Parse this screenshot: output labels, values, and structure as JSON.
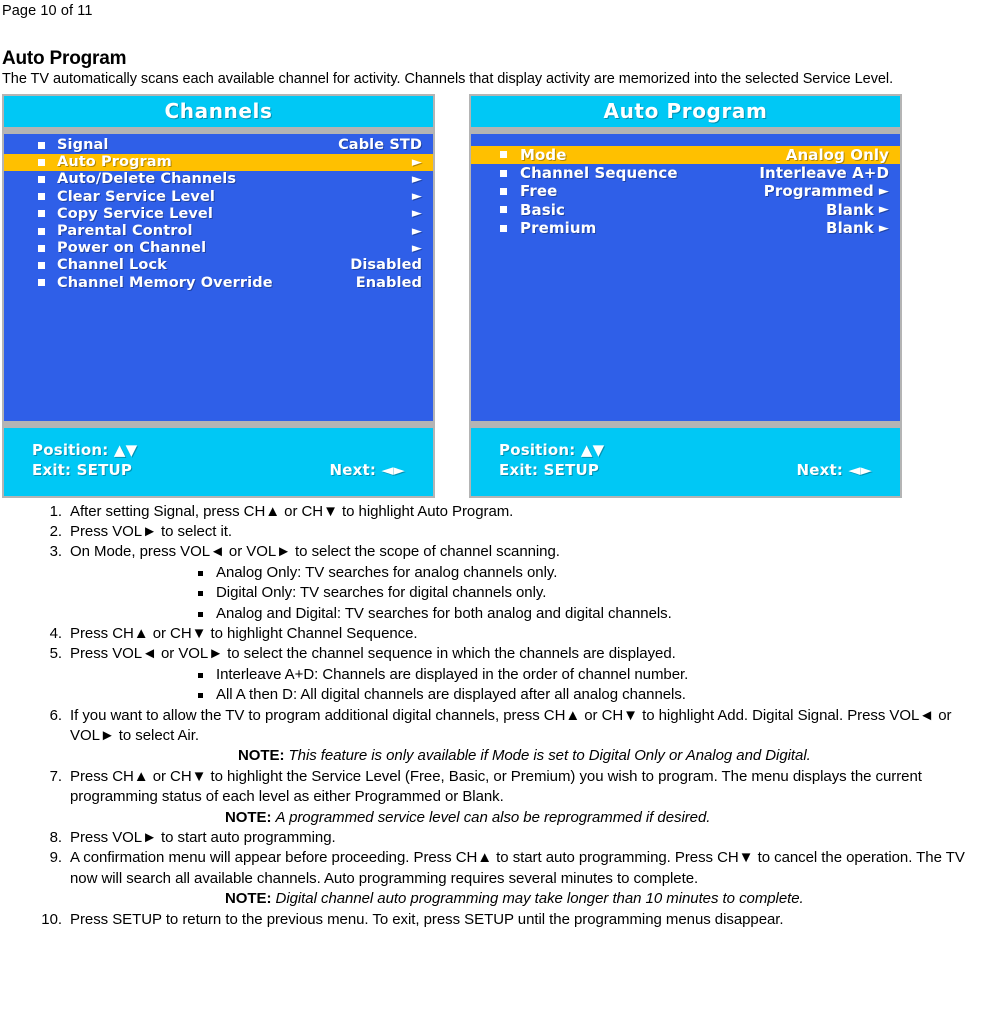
{
  "page_header": "Page 10 of 11",
  "section": {
    "title": "Auto Program",
    "intro": "The TV automatically scans each available channel for activity. Channels that display activity are memorized into the selected Service Level."
  },
  "colors": {
    "osd_header_bg": "#00c8f5",
    "osd_body_bg": "#2f5fe8",
    "osd_highlight_bg": "#ffc000",
    "osd_border": "#b4b4b4",
    "osd_text": "#ffffff"
  },
  "osd_panels": [
    {
      "id": "channels-menu",
      "title": "Channels",
      "rows": [
        {
          "label": "Signal",
          "value": "Cable STD",
          "arrow": "",
          "selected": false
        },
        {
          "label": "Auto Program",
          "value": "",
          "arrow": "►",
          "selected": true
        },
        {
          "label": "Auto/Delete Channels",
          "value": "",
          "arrow": "►",
          "selected": false
        },
        {
          "label": "Clear Service Level",
          "value": "",
          "arrow": "►",
          "selected": false
        },
        {
          "label": "Copy Service Level",
          "value": "",
          "arrow": "►",
          "selected": false
        },
        {
          "label": "Parental Control",
          "value": "",
          "arrow": "►",
          "selected": false
        },
        {
          "label": "Power on Channel",
          "value": "",
          "arrow": "►",
          "selected": false
        },
        {
          "label": "Channel Lock",
          "value": "Disabled",
          "arrow": "",
          "selected": false
        },
        {
          "label": "Channel Memory Override",
          "value": "Enabled",
          "arrow": "",
          "selected": false
        }
      ],
      "footer": {
        "position": "Position: ▲▼",
        "exit": "Exit: SETUP",
        "next": "Next: ◄►"
      }
    },
    {
      "id": "auto-program-menu",
      "title": "Auto Program",
      "rows": [
        {
          "label": "Mode",
          "value": "Analog Only",
          "arrow": "",
          "selected": true
        },
        {
          "label": "Channel Sequence",
          "value": "Interleave A+D",
          "arrow": "",
          "selected": false
        },
        {
          "label": "Free",
          "value": "Programmed",
          "arrow": "►",
          "selected": false
        },
        {
          "label": "Basic",
          "value": "Blank",
          "arrow": "►",
          "selected": false
        },
        {
          "label": "Premium",
          "value": "Blank",
          "arrow": "►",
          "selected": false
        }
      ],
      "footer": {
        "position": "Position: ▲▼",
        "exit": "Exit: SETUP",
        "next": "Next: ◄►"
      }
    }
  ],
  "steps": [
    {
      "num": "1.",
      "text": "After setting Signal, press CH▲ or CH▼ to highlight Auto Program.",
      "subitems": [],
      "notes": []
    },
    {
      "num": "2.",
      "text": "Press VOL► to select it.",
      "subitems": [],
      "notes": []
    },
    {
      "num": "3.",
      "text": "On Mode, press VOL◄ or VOL► to select the scope of channel scanning.",
      "subitems": [
        "Analog Only: TV searches for analog channels only.",
        "Digital Only: TV searches for digital channels only.",
        "Analog and Digital: TV searches for both analog and digital channels."
      ],
      "notes": []
    },
    {
      "num": "4.",
      "text": "Press CH▲ or CH▼ to highlight Channel Sequence.",
      "subitems": [],
      "notes": []
    },
    {
      "num": "5.",
      "text": "Press VOL◄ or VOL► to select the channel sequence in which the channels are displayed.",
      "subitems": [
        "Interleave A+D: Channels are displayed in the order of channel number.",
        "All A then D: All digital channels are displayed after all analog channels."
      ],
      "notes": []
    },
    {
      "num": "6.",
      "text": "If you want to allow the TV to program additional digital channels, press CH▲ or CH▼ to highlight Add. Digital Signal.  Press VOL◄ or VOL► to select Air.",
      "subitems": [],
      "notes": [
        {
          "label": "NOTE:",
          "text": "This feature is only available if Mode is set to Digital Only or Analog and Digital.",
          "indent": "normal"
        }
      ]
    },
    {
      "num": "7.",
      "text": "Press CH▲ or CH▼ to highlight the Service Level (Free, Basic, or Premium) you wish to program. The menu displays the current programming status of each level as either Programmed or Blank.",
      "subitems": [],
      "notes": [
        {
          "label": "NOTE:",
          "text": "A programmed service level can also be reprogrammed if desired.",
          "indent": "deep"
        }
      ]
    },
    {
      "num": "8.",
      "text": "Press VOL► to start auto programming.",
      "subitems": [],
      "notes": []
    },
    {
      "num": "9.",
      "text": "A confirmation menu will appear before proceeding. Press CH▲ to start auto programming. Press CH▼ to cancel the operation. The TV now will search all available channels.  Auto programming requires several minutes to complete.",
      "subitems": [],
      "notes": [
        {
          "label": "NOTE:",
          "text": "Digital channel auto programming may take longer than 10 minutes to complete.",
          "indent": "deep"
        }
      ]
    },
    {
      "num": "10.",
      "text": "Press SETUP to return to the previous menu. To exit, press SETUP until the programming menus disappear.",
      "subitems": [],
      "notes": []
    }
  ]
}
